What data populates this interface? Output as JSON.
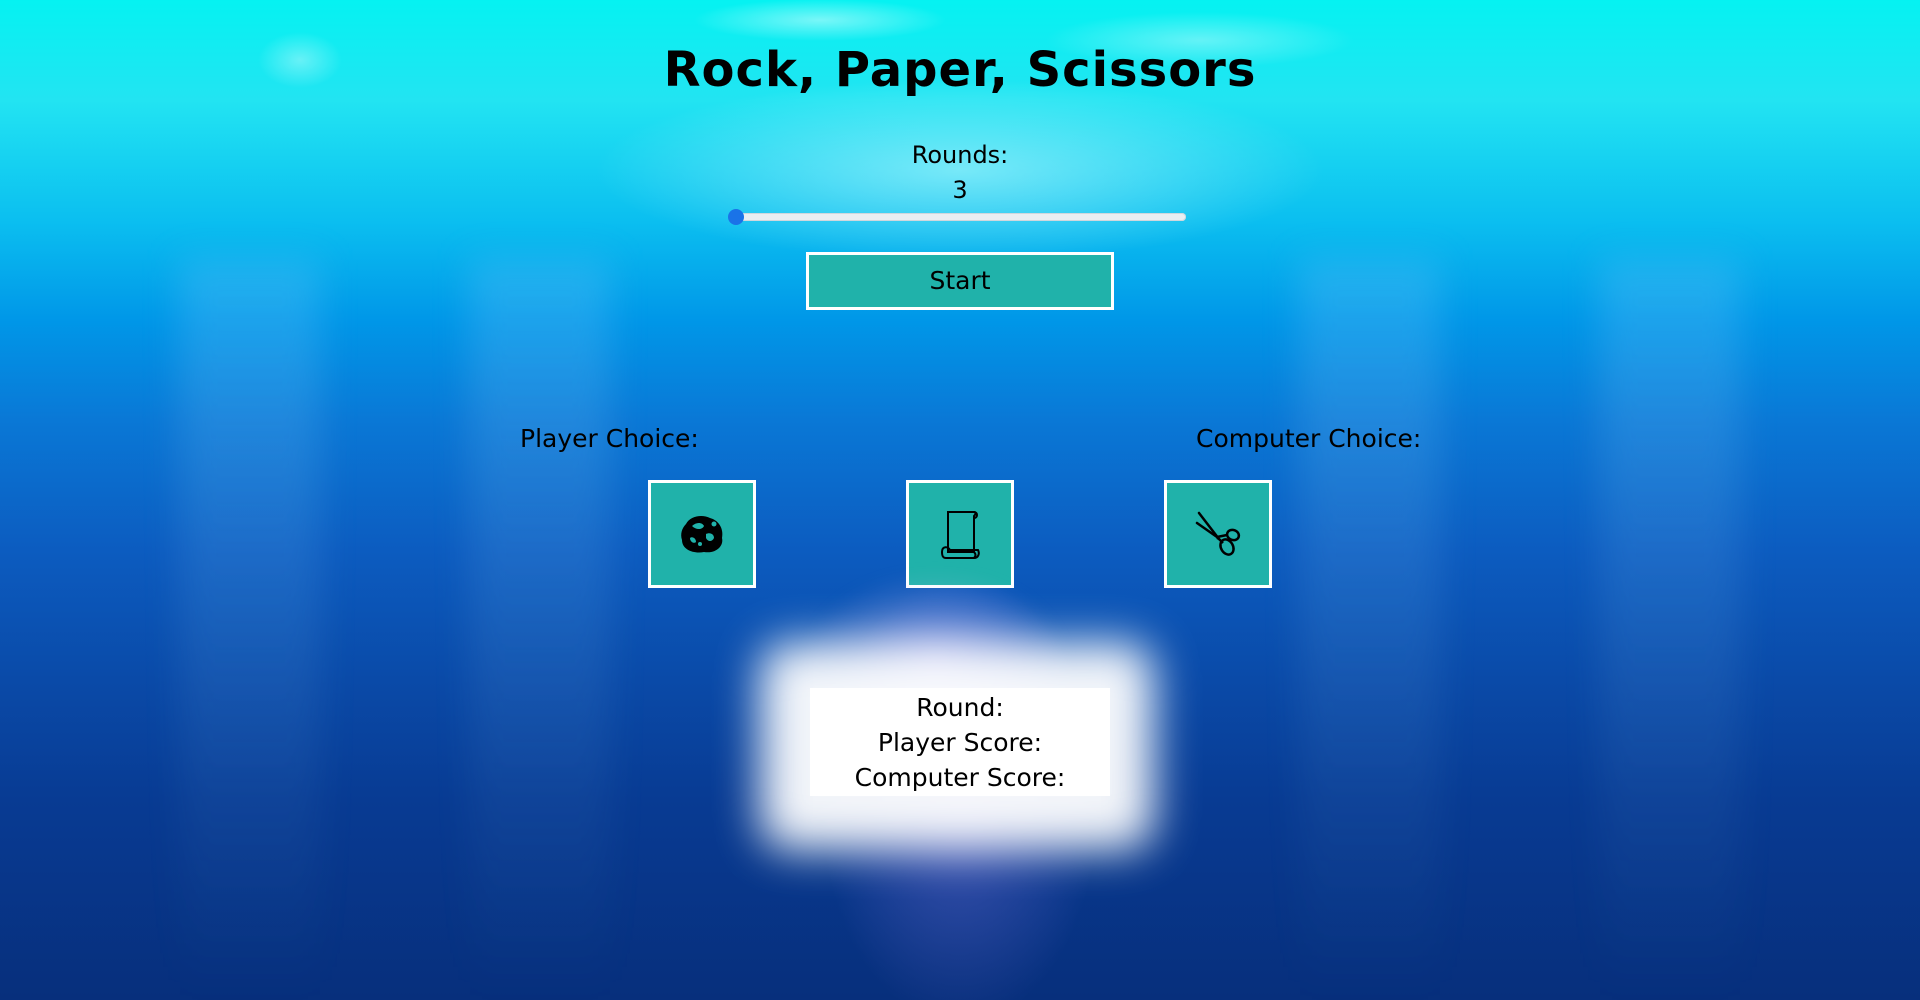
{
  "title": "Rock, Paper, Scissors",
  "rounds": {
    "label": "Rounds:",
    "value": "3",
    "slider_fraction": 0
  },
  "start_button": {
    "label": "Start"
  },
  "choices": {
    "player_label": "Player Choice:",
    "computer_label": "Computer Choice:",
    "options": [
      {
        "name": "rock",
        "icon": "rock-icon"
      },
      {
        "name": "paper",
        "icon": "paper-scroll-icon"
      },
      {
        "name": "scissors",
        "icon": "scissors-icon"
      }
    ]
  },
  "score": {
    "round_label": "Round:",
    "player_score_label": "Player Score:",
    "computer_score_label": "Computer Score:"
  },
  "colors": {
    "button_bg": "#20b2aa",
    "button_border": "#ffffff",
    "slider_thumb": "#1a73e8"
  }
}
